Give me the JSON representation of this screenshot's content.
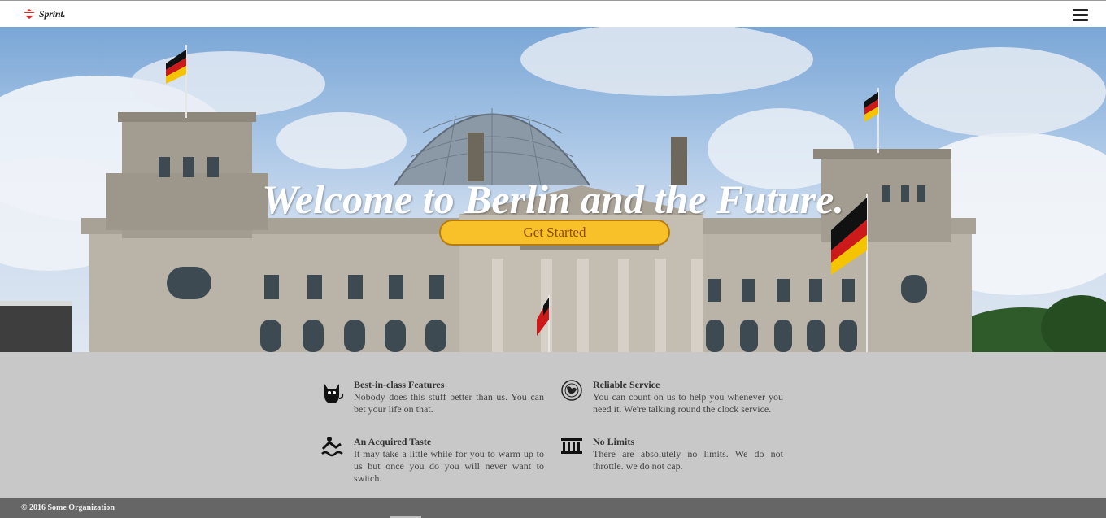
{
  "header": {
    "logo_text": "Sprint.",
    "menu_icon": "hamburger-menu-icon"
  },
  "hero": {
    "headline": "Welcome to Berlin and the Future.",
    "cta_label": "Get Started",
    "colors": {
      "cta_bg": "#f8c12a",
      "cta_border": "#b57d10",
      "cta_text": "#8a4a10"
    }
  },
  "features": [
    {
      "icon": "cat-icon",
      "title": "Best-in-class Features",
      "description": "Nobody does this stuff better than us. You can bet your life on that."
    },
    {
      "icon": "globe-icon",
      "title": "Reliable Service",
      "description": "You can count on us to help you whenever you need it. We're talking round the clock service."
    },
    {
      "icon": "swimmer-icon",
      "title": "An Acquired Taste",
      "description": "It may take a little while for you to warm up to us but once you do you will never want to switch."
    },
    {
      "icon": "bank-icon",
      "title": "No Limits",
      "description": "There are absolutely no limits. We do not throttle. we do not cap."
    }
  ],
  "footer": {
    "copyright": "© 2016 Some Organization"
  }
}
